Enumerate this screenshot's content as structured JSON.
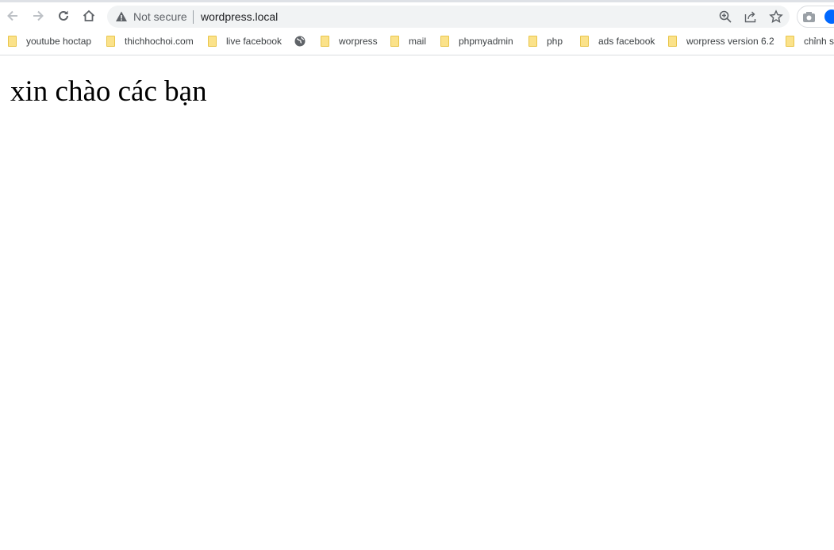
{
  "browser": {
    "security_label": "Not secure",
    "url": "wordpress.local",
    "icons": {
      "back": "arrow-left-icon",
      "forward": "arrow-right-icon",
      "reload": "reload-icon",
      "home": "home-icon",
      "warning": "warning-icon",
      "zoom": "zoom-in-icon",
      "share": "share-icon",
      "bookmark": "star-icon",
      "camera": "camera-icon"
    },
    "bookmarks": [
      {
        "label": "youtube hoctap",
        "icon": "folder"
      },
      {
        "label": "thichhochoi.com",
        "icon": "folder"
      },
      {
        "label": "live facebook",
        "icon": "folder"
      },
      {
        "label": "",
        "icon": "globe"
      },
      {
        "label": "worpress",
        "icon": "folder"
      },
      {
        "label": "mail",
        "icon": "folder"
      },
      {
        "label": "phpmyadmin",
        "icon": "folder"
      },
      {
        "label": "php",
        "icon": "folder"
      },
      {
        "label": "ads facebook",
        "icon": "folder"
      },
      {
        "label": "worpress version 6.2",
        "icon": "folder"
      },
      {
        "label": "chỉnh sử",
        "icon": "folder"
      }
    ]
  },
  "page": {
    "heading": "xin chào các bạn"
  }
}
